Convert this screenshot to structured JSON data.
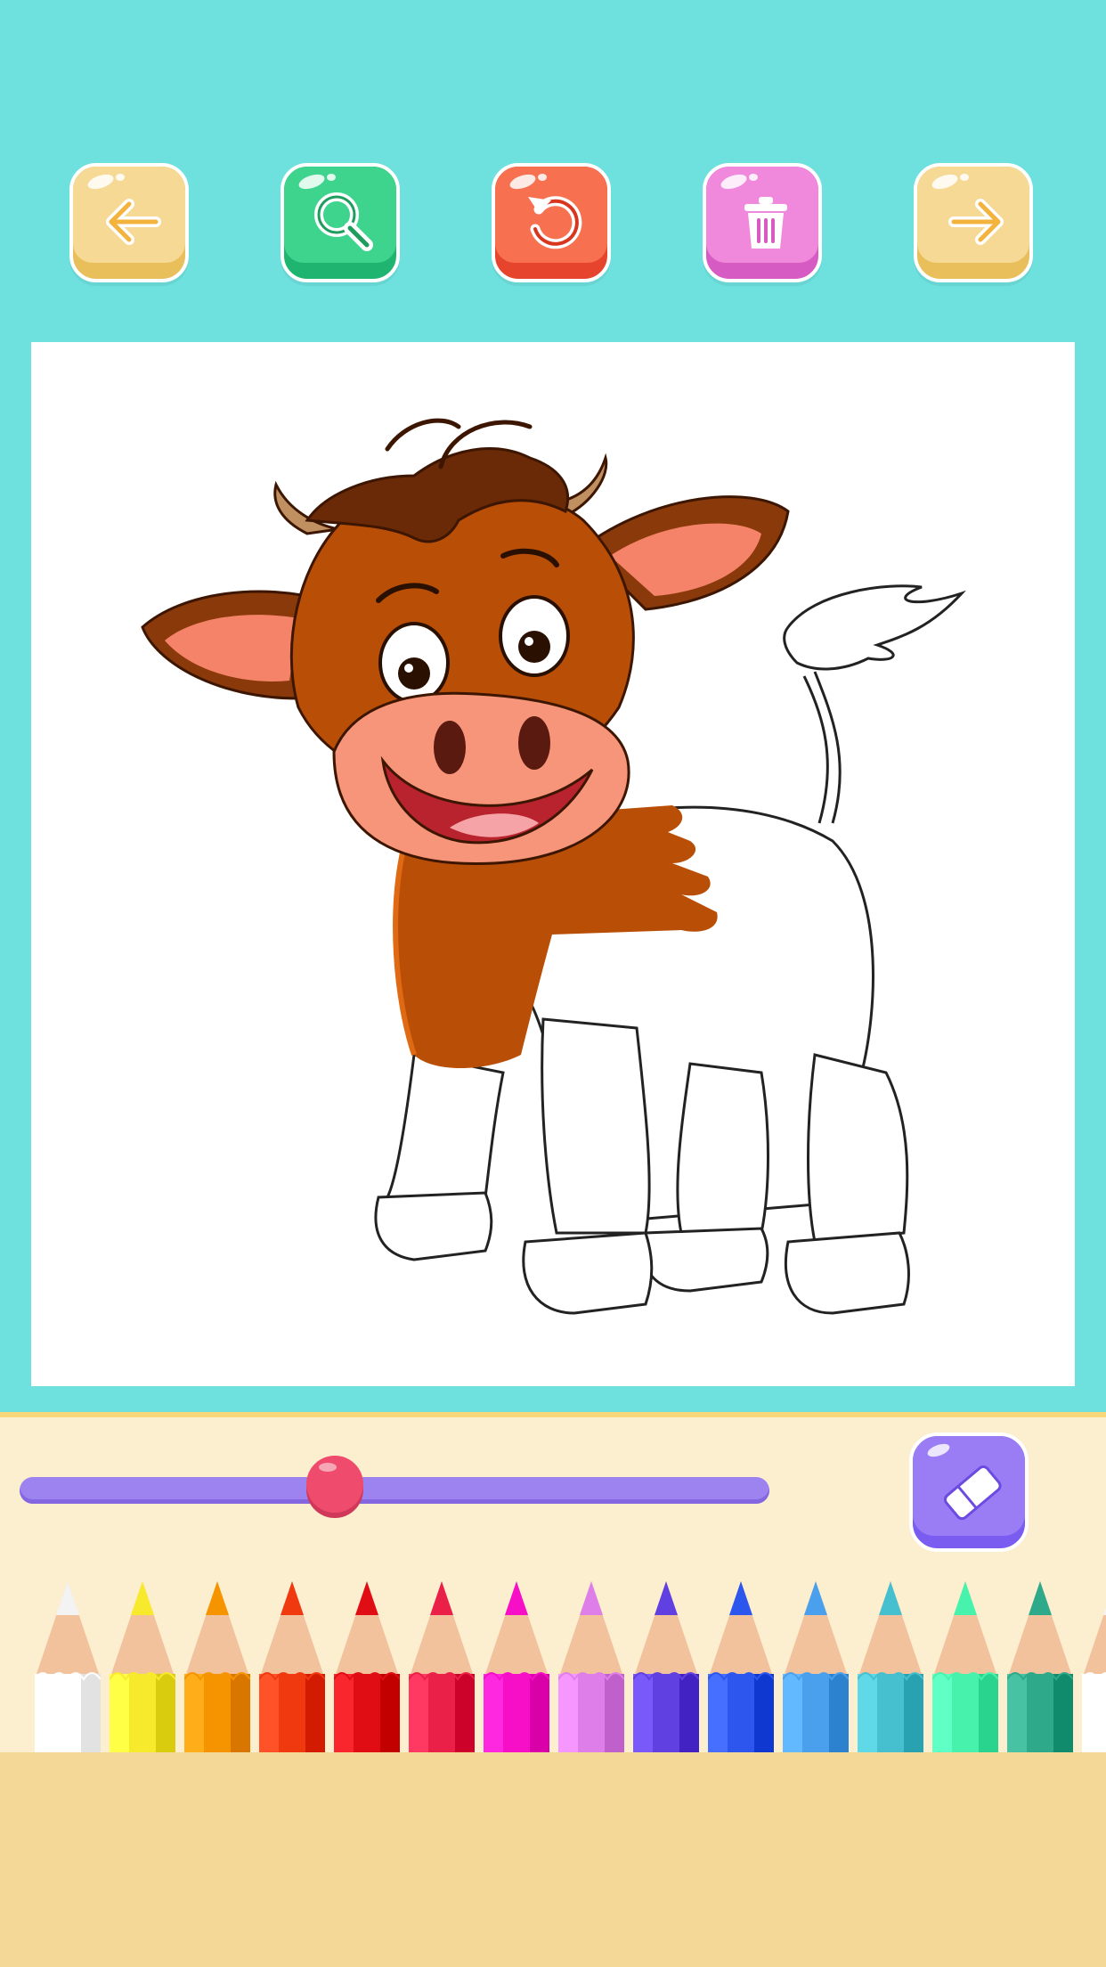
{
  "toolbar": {
    "buttons": [
      {
        "name": "back-button",
        "icon": "arrow-left-icon",
        "color": "#f1d27f"
      },
      {
        "name": "zoom-button",
        "icon": "magnifier-icon",
        "color": "#3cd08c"
      },
      {
        "name": "undo-button",
        "icon": "undo-icon",
        "color": "#f56b4c"
      },
      {
        "name": "clear-button",
        "icon": "trash-icon",
        "color": "#ef82d9"
      },
      {
        "name": "next-button",
        "icon": "arrow-right-icon",
        "color": "#f1d27f"
      }
    ]
  },
  "canvas": {
    "subject": "cow-drawing-icon"
  },
  "brush": {
    "size_fraction": 0.42,
    "eraser_icon": "eraser-icon"
  },
  "palette": {
    "pencil_colors": [
      "#ffffff",
      "#f7ea2c",
      "#f69400",
      "#f0390f",
      "#e00e14",
      "#ea2049",
      "#f70fc8",
      "#dd7ee9",
      "#6040e0",
      "#2d56ee",
      "#4aa0ec",
      "#46c0cf",
      "#47f2ac",
      "#2ea98a",
      "#ffffff"
    ]
  },
  "colors": {
    "background": "#6ee1de",
    "panel": "#fcefd0",
    "slider": "#9c83f0",
    "thumb": "#ef4c6d"
  }
}
